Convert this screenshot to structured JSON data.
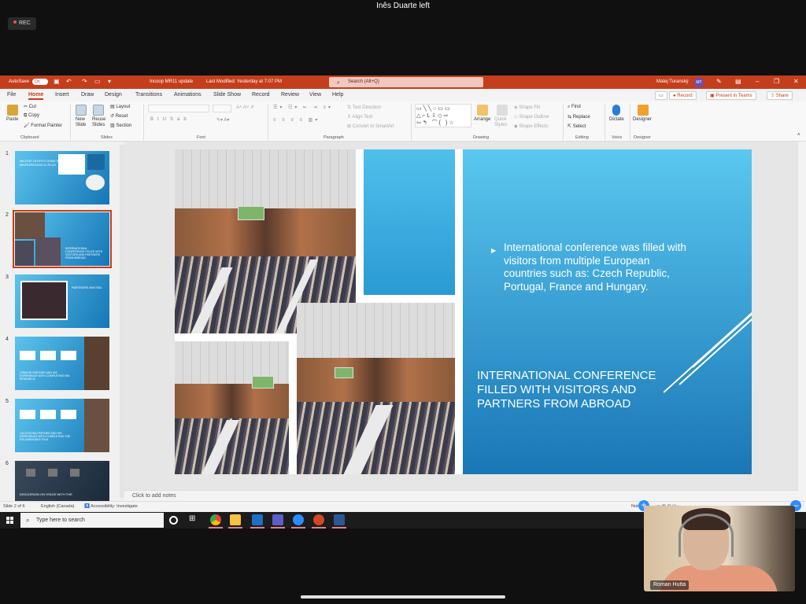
{
  "meeting": {
    "title": "Inês Duarte left",
    "rec_label": "REC"
  },
  "titlebar": {
    "autosave": "AutoSave",
    "autosave_state": "On",
    "doc_title": "Incoop MR11 update",
    "last_modified": "Last Modified: Yesterday at 7:07 PM",
    "search_placeholder": "Search (Alt+Q)",
    "user_name": "Matej Turanský",
    "user_initials": "MT"
  },
  "menubar": {
    "tabs": [
      "File",
      "Home",
      "Insert",
      "Draw",
      "Design",
      "Transitions",
      "Animations",
      "Slide Show",
      "Record",
      "Review",
      "View",
      "Help"
    ],
    "record_btn": "Record",
    "present_btn": "Present in Teams",
    "share_btn": "Share"
  },
  "ribbon": {
    "clipboard": {
      "paste": "Paste",
      "cut": "Cut",
      "copy": "Copy",
      "format_painter": "Format Painter",
      "label": "Clipboard"
    },
    "slides": {
      "new_slide": "New Slide",
      "reuse_slides": "Reuse Slides",
      "layout": "Layout",
      "reset": "Reset",
      "section": "Section",
      "label": "Slides"
    },
    "font": {
      "label": "Font"
    },
    "paragraph": {
      "text_direction": "Text Direction",
      "align_text": "Align Text",
      "convert_smartart": "Convert to SmartArt",
      "label": "Paragraph"
    },
    "drawing": {
      "arrange": "Arrange",
      "quick_styles": "Quick Styles",
      "shape_fill": "Shape Fill",
      "shape_outline": "Shape Outline",
      "shape_effects": "Shape Effects",
      "label": "Drawing"
    },
    "editing": {
      "find": "Find",
      "replace": "Replace",
      "select": "Select",
      "label": "Editing"
    },
    "voice": {
      "dictate": "Dictate",
      "label": "Voice"
    },
    "designer": {
      "designer": "Designer",
      "label": "Designer"
    }
  },
  "thumbnails": {
    "numbers": [
      "1",
      "2",
      "3",
      "4",
      "5",
      "6"
    ],
    "slide1_text": "INCOOP OUTPUT DONE BY MICROREGION 11 PLUS",
    "slide2_text": "INTERNATIONAL CONFERENCE FILLED WITH VISITORS AND PARTNERS FROM ABROAD",
    "slide3_text": "PARTNERS INVITED",
    "slide4_text": "CIRKEVE PARTNER AND HIS EXPERIENCE WITH COMPLETING HIS RESEARCH",
    "slide5_text": "LACCESONA PARTNER AND HIS EXPERIENCE WITH COMPLETING THE DOCUMENTARY FILM",
    "slide6_text": "DISCUSSION ON STAGE WITH THE"
  },
  "slide": {
    "bullet": "International conference was filled with visitors from multiple European countries such as: Czech Republic, Portugal, France and Hungary.",
    "title": "INTERNATIONAL CONFERENCE FILLED WITH VISITORS AND PARTNERS FROM ABROAD"
  },
  "notes": {
    "placeholder": "Click to add notes"
  },
  "status": {
    "slide_counter": "Slide 2 of 6",
    "language": "English (Canada)",
    "accessibility": "Accessibility: Investigate",
    "notes": "Notes"
  },
  "taskbar": {
    "search_placeholder": "Type here to search"
  },
  "webcam": {
    "participant": "Roman Hutta"
  },
  "colors": {
    "ppt_accent": "#c43e1c",
    "slide_blue": "#2a9ad4"
  }
}
